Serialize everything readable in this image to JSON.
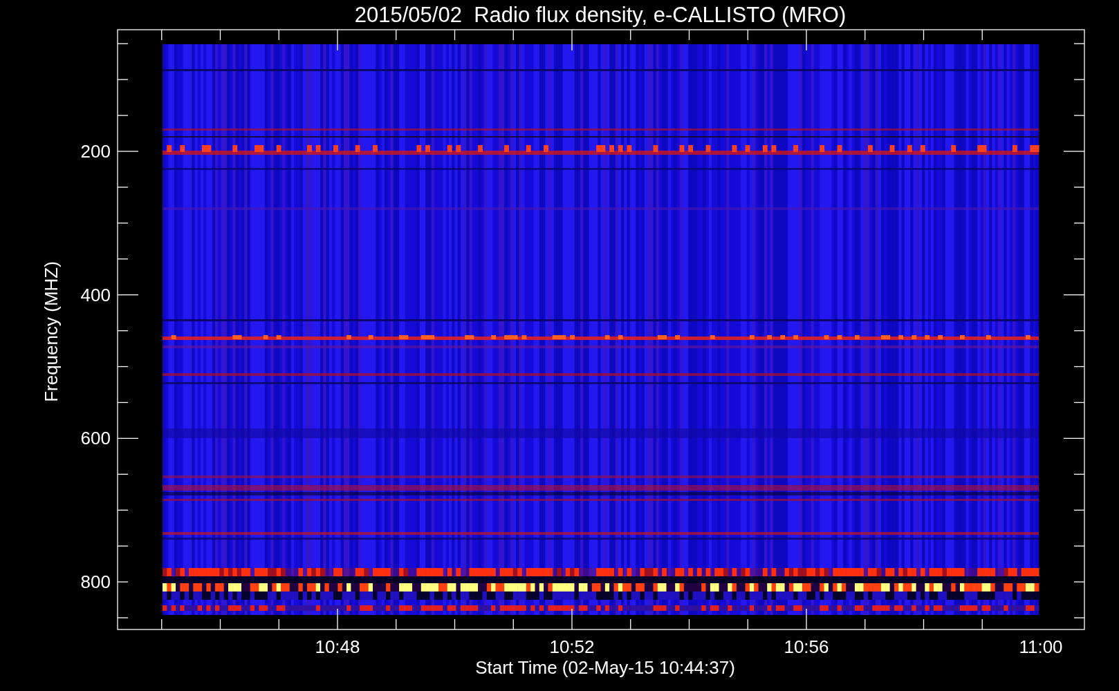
{
  "title": "2015/05/02  Radio flux density, e-CALLISTO (MRO)",
  "y_axis": {
    "label": "Frequency (MHZ)",
    "ticks": [
      "200",
      "400",
      "600",
      "800"
    ]
  },
  "x_axis": {
    "label": "Start Time (02-May-15 10:44:37)",
    "ticks": [
      "10:48",
      "10:52",
      "10:56",
      "11:00"
    ]
  }
}
